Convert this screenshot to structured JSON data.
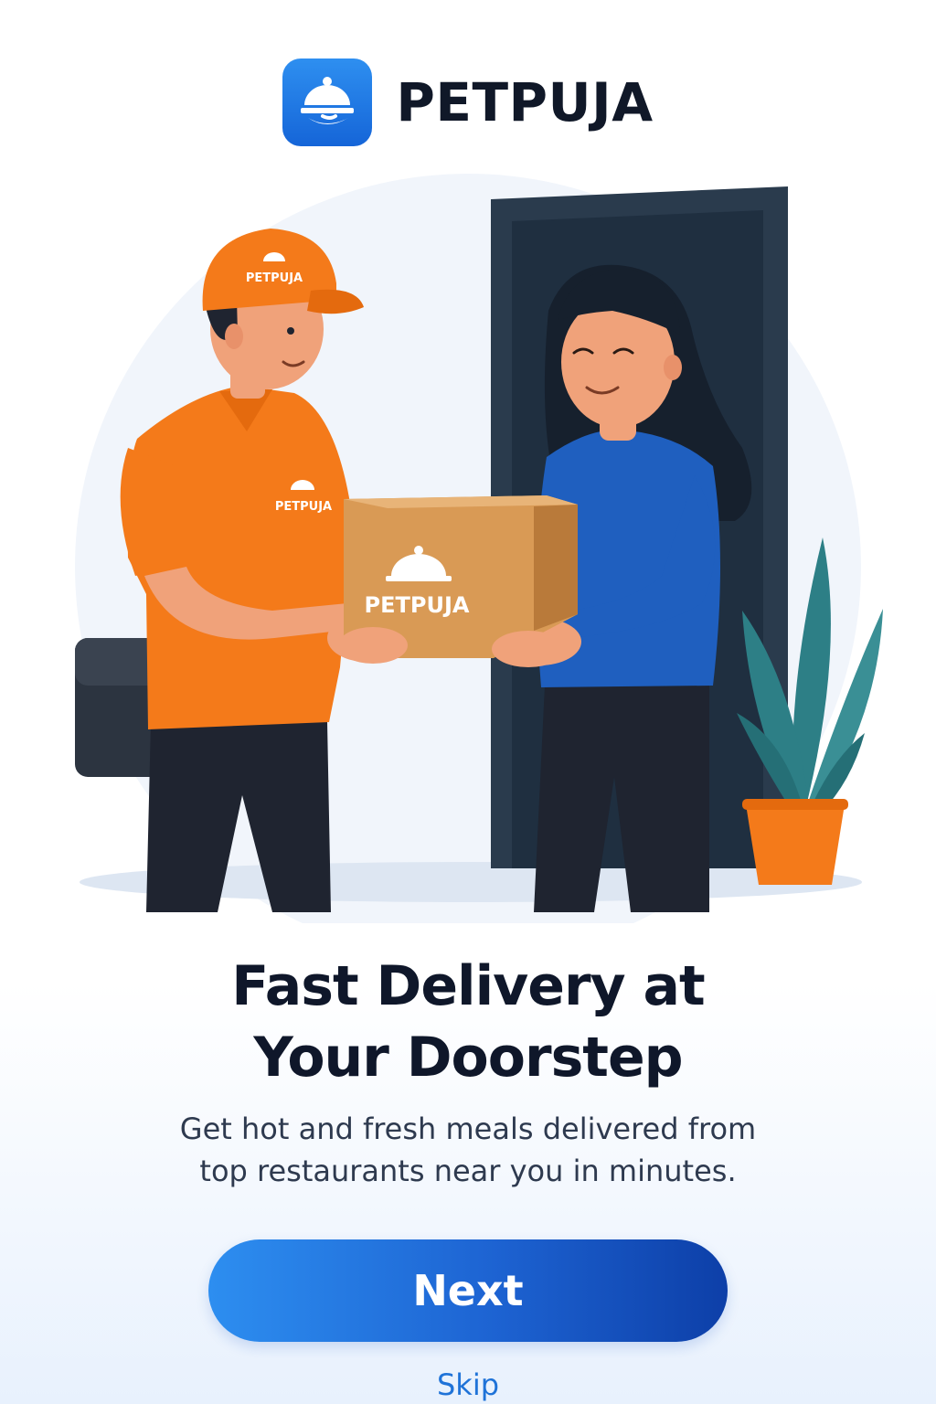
{
  "brand": {
    "name": "PETPUJA",
    "logo_icon": "cloche-icon"
  },
  "illustration": {
    "cap_text": "PETPUJA",
    "shirt_text": "PETPUJA",
    "box_text": "PETPUJA",
    "colors": {
      "uniform": "#f47a1a",
      "box": "#d99a55",
      "sweater": "#1f5fbf",
      "door": "#1f2f40",
      "plant": "#2d7f86",
      "pot": "#f47a1a"
    }
  },
  "onboarding": {
    "title_line1": "Fast Delivery at",
    "title_line2": "Your Doorstep",
    "subtitle_line1": "Get hot and fresh meals delivered from",
    "subtitle_line2": "top restaurants near you in minutes."
  },
  "actions": {
    "next_label": "Next",
    "skip_label": "Skip"
  },
  "theme": {
    "accent": "#1d6ee0",
    "text_dark": "#0f172a"
  }
}
